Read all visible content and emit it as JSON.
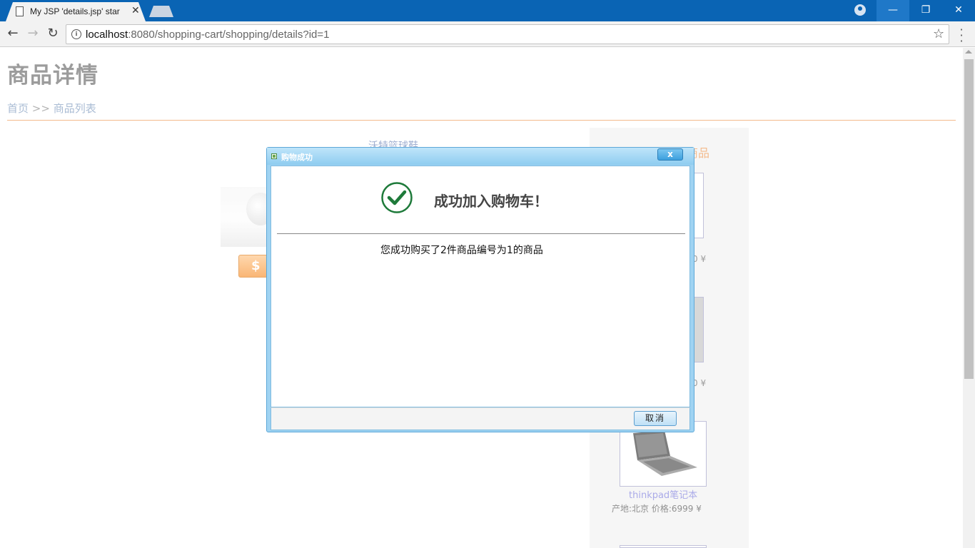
{
  "browser": {
    "tab_title": "My JSP 'details.jsp' star",
    "url_host": "localhost",
    "url_rest": ":8080/shopping-cart/shopping/details?id=1",
    "accent_color": "#0a64b4"
  },
  "page": {
    "title": "商品详情",
    "breadcrumb_home": "首页",
    "breadcrumb_sep": " >> ",
    "breadcrumb_list": "商品列表",
    "product_name": "沃特篮球鞋",
    "buy_symbol": "$"
  },
  "sidebar": {
    "title": "您浏览过的商品",
    "price_frag_1": "0 ¥",
    "price_frag_2": "0 ¥",
    "item_name": "thinkpad笔记本",
    "item_meta": "产地:北京  价格:6999 ¥"
  },
  "dialog": {
    "title": "购物成功",
    "close_label": "x",
    "success_title": "成功加入购物车！",
    "message": "您成功购买了2件商品编号为1的商品",
    "cancel_label": "取消",
    "check_color": "#1e7a3a"
  }
}
